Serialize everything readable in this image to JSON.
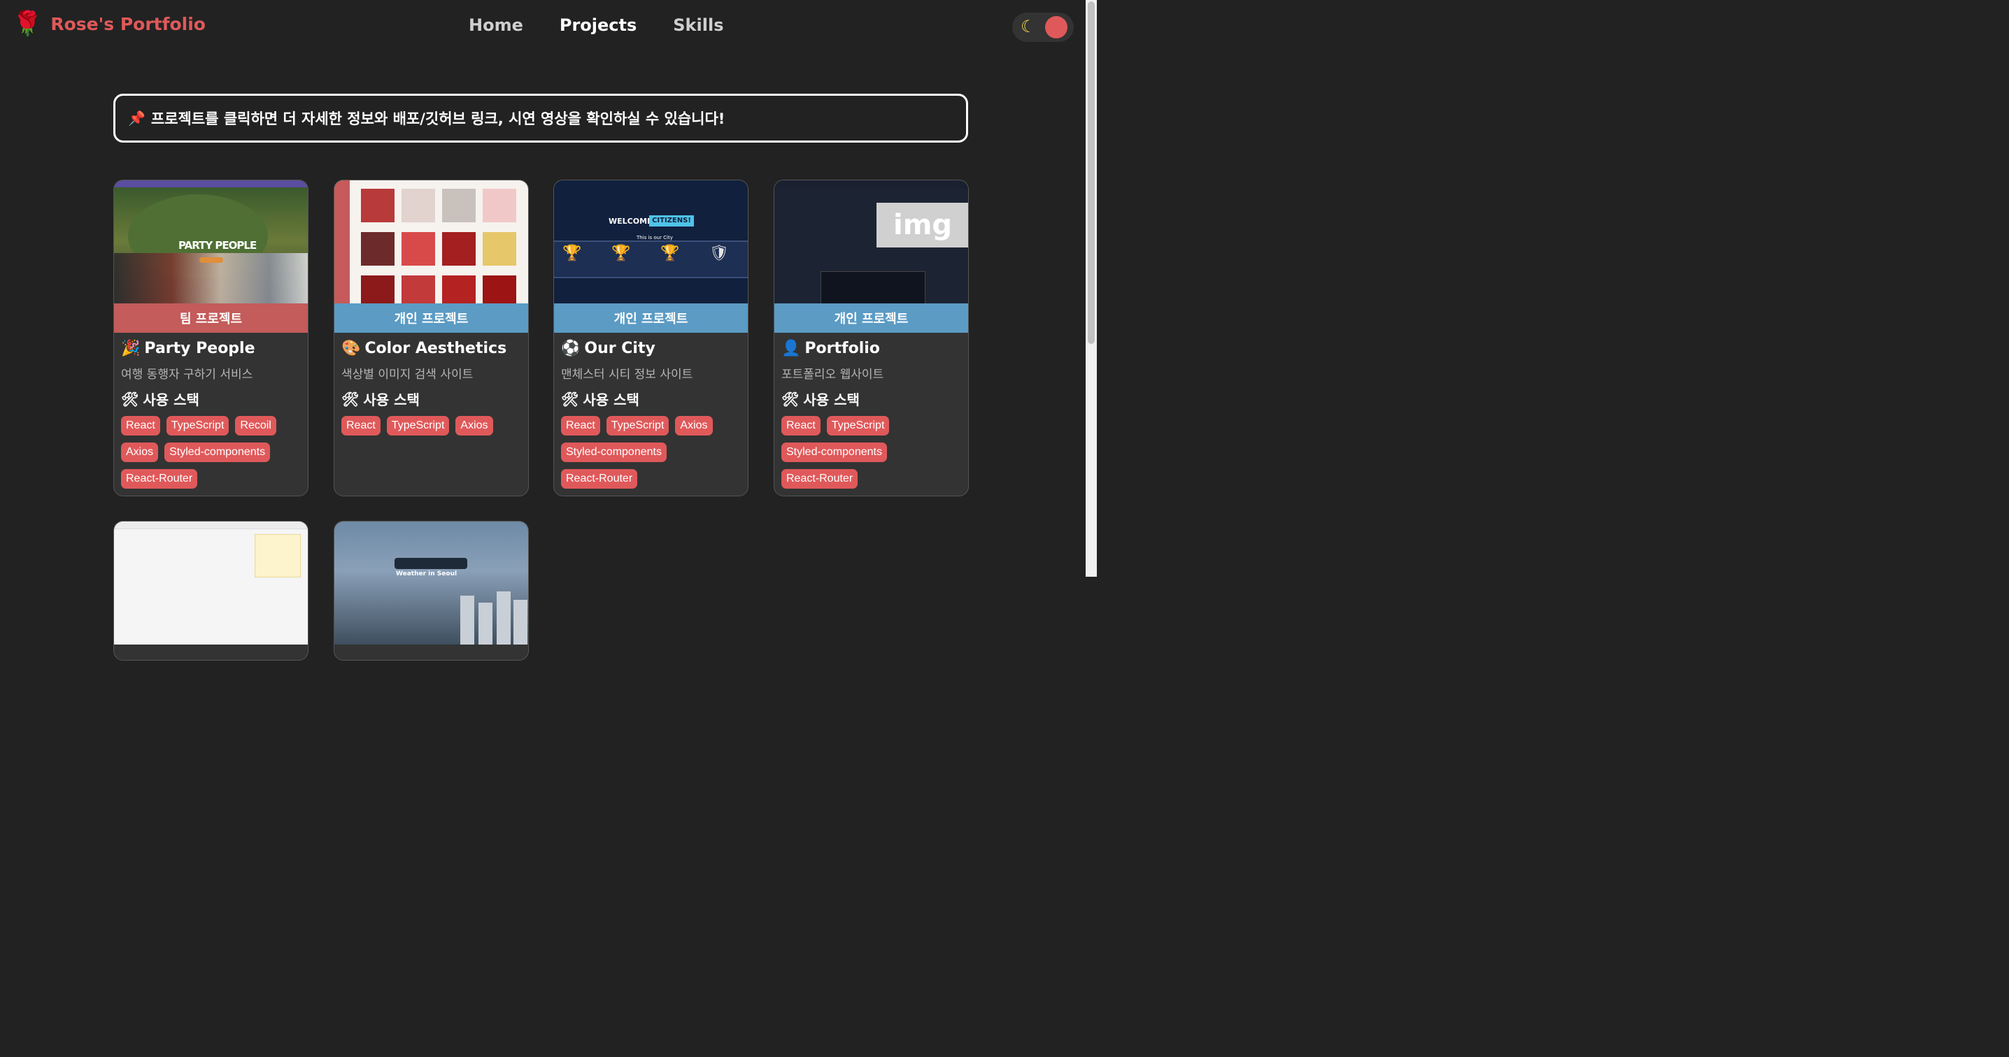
{
  "header": {
    "logo_icon": "🌹",
    "logo_text": "Rose's Portfolio",
    "nav": [
      "Home",
      "Projects",
      "Skills"
    ],
    "active_nav": "Projects",
    "theme_icon": "moon-star-icon"
  },
  "notice": {
    "icon": "📌",
    "text": "프로젝트를 클릭하면 더 자세한 정보와 배포/깃허브 링크, 시연 영상을 확인하실 수 있습니다!"
  },
  "cards": [
    {
      "type": "팀 프로젝트",
      "icon": "🎉",
      "title": "Party People",
      "desc": "여행 동행자 구하기 서비스",
      "stack_icon": "🛠",
      "stack_label": "사용 스택",
      "tags": [
        "React",
        "TypeScript",
        "Recoil",
        "Axios",
        "Styled-components",
        "React-Router"
      ],
      "thumb_text": "PARTY PEOPLE"
    },
    {
      "type": "개인 프로젝트",
      "icon": "🎨",
      "title": "Color Aesthetics",
      "desc": "색상별 이미지 검색 사이트",
      "stack_icon": "🛠",
      "stack_label": "사용 스택",
      "tags": [
        "React",
        "TypeScript",
        "Axios"
      ]
    },
    {
      "type": "개인 프로젝트",
      "icon": "⚽",
      "title": "Our City",
      "desc": "맨체스터 시티 정보 사이트",
      "stack_icon": "🛠",
      "stack_label": "사용 스택",
      "tags": [
        "React",
        "TypeScript",
        "Axios",
        "Styled-components",
        "React-Router"
      ],
      "thumb_welcome": "WELCOME,",
      "thumb_citizens": "CITIZENS!",
      "thumb_sub": "This is our City"
    },
    {
      "type": "개인 프로젝트",
      "icon": "👤",
      "title": "Portfolio",
      "desc": "포트폴리오 웹사이트",
      "stack_icon": "🛠",
      "stack_label": "사용 스택",
      "tags": [
        "React",
        "TypeScript",
        "Styled-components",
        "React-Router"
      ],
      "thumb_img": "img"
    }
  ],
  "partial_cards": [
    {
      "thumb": "q-and-a-board"
    },
    {
      "thumb": "weather",
      "thumb_text": "Weather in Seoul"
    }
  ],
  "colors": {
    "accent": "#e0595a",
    "team_band": "#c35c5a",
    "personal_band": "#5b9bc4",
    "background": "#222222"
  }
}
